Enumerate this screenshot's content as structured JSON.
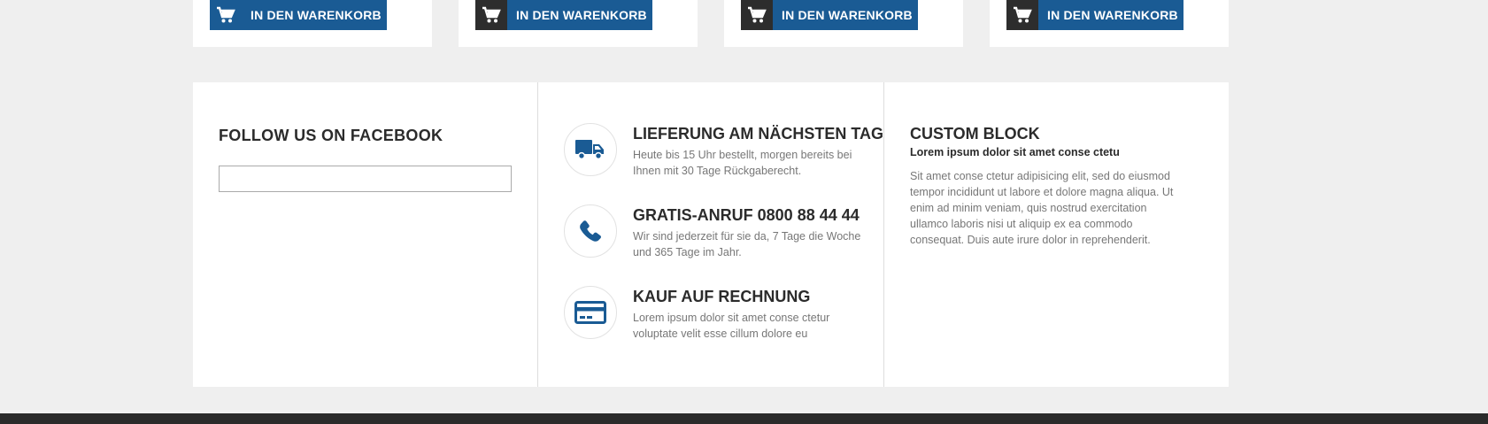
{
  "products": {
    "cart_label": "IN DEN WARENKORB",
    "cards": [
      {
        "icon": "cart-icon",
        "variant": "blue"
      },
      {
        "icon": "cart-icon",
        "variant": "dark"
      },
      {
        "icon": "cart-icon",
        "variant": "dark"
      },
      {
        "icon": "cart-icon",
        "variant": "dark"
      }
    ]
  },
  "facebook": {
    "title": "FOLLOW US ON FACEBOOK"
  },
  "features": [
    {
      "icon": "truck-icon",
      "title": "LIEFERUNG AM NÄCHSTEN TAG",
      "text": "Heute bis 15 Uhr bestellt, morgen bereits bei Ihnen mit 30 Tage Rückgaberecht."
    },
    {
      "icon": "phone-icon",
      "title": "GRATIS-ANRUF 0800 88 44 44",
      "text": "Wir sind jederzeit für sie da, 7 Tage die Woche und 365 Tage im Jahr."
    },
    {
      "icon": "credit-card-icon",
      "title": "KAUF AUF RECHNUNG",
      "text": "Lorem ipsum dolor sit amet conse ctetur voluptate velit esse cillum dolore eu"
    }
  ],
  "custom_block": {
    "title": "CUSTOM BLOCK",
    "subtitle": "Lorem ipsum dolor sit amet conse ctetu",
    "text": "Sit amet conse ctetur adipisicing elit, sed do eiusmod tempor incididunt ut labore et dolore magna aliqua. Ut enim ad minim veniam, quis nostrud exercitation ullamco laboris nisi ut aliquip ex ea commodo consequat. Duis aute irure dolor in reprehenderit."
  },
  "colors": {
    "accent": "#1a5b94",
    "dark": "#2d2d2d",
    "background": "#efefef"
  }
}
